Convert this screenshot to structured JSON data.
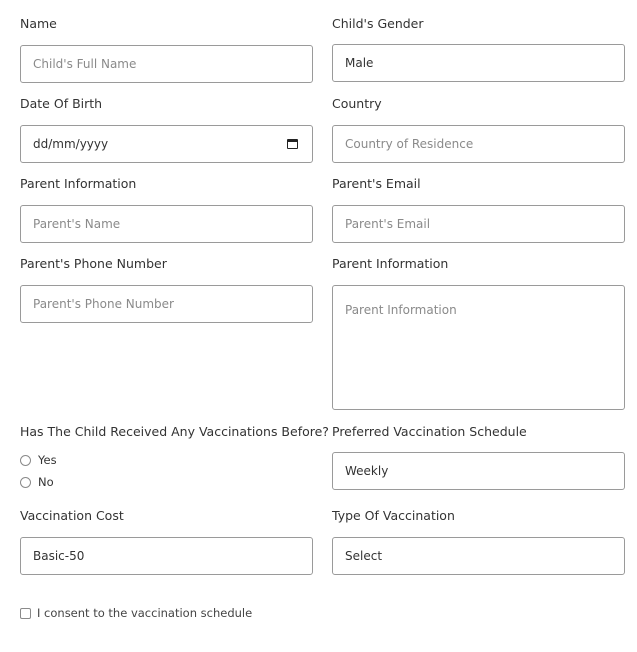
{
  "form": {
    "name": {
      "label": "Name",
      "placeholder": "Child's Full Name",
      "value": ""
    },
    "gender": {
      "label": "Child's Gender",
      "value": "Male"
    },
    "dob": {
      "label": "Date Of Birth",
      "value": "dd/mm/yyyy",
      "icon": "calendar-icon"
    },
    "country": {
      "label": "Country",
      "placeholder": "Country of Residence"
    },
    "parent_info": {
      "label": "Parent Information",
      "placeholder": "Parent's Name"
    },
    "parent_email": {
      "label": "Parent's Email",
      "placeholder": "Parent's Email"
    },
    "parent_phone": {
      "label": "Parent's Phone Number",
      "placeholder": "Parent's Phone Number"
    },
    "parent_info_area": {
      "label": "Parent Information",
      "placeholder": "Parent Information"
    },
    "prior_vaccinations": {
      "label": "Has The Child Received Any Vaccinations Before?",
      "options": [
        "Yes",
        "No"
      ]
    },
    "schedule": {
      "label": "Preferred Vaccination Schedule",
      "value": "Weekly"
    },
    "cost": {
      "label": "Vaccination Cost",
      "value": "Basic-50"
    },
    "vaccination_type": {
      "label": "Type Of Vaccination",
      "value": "Select"
    },
    "consent": {
      "label": "I consent to the vaccination schedule"
    }
  }
}
